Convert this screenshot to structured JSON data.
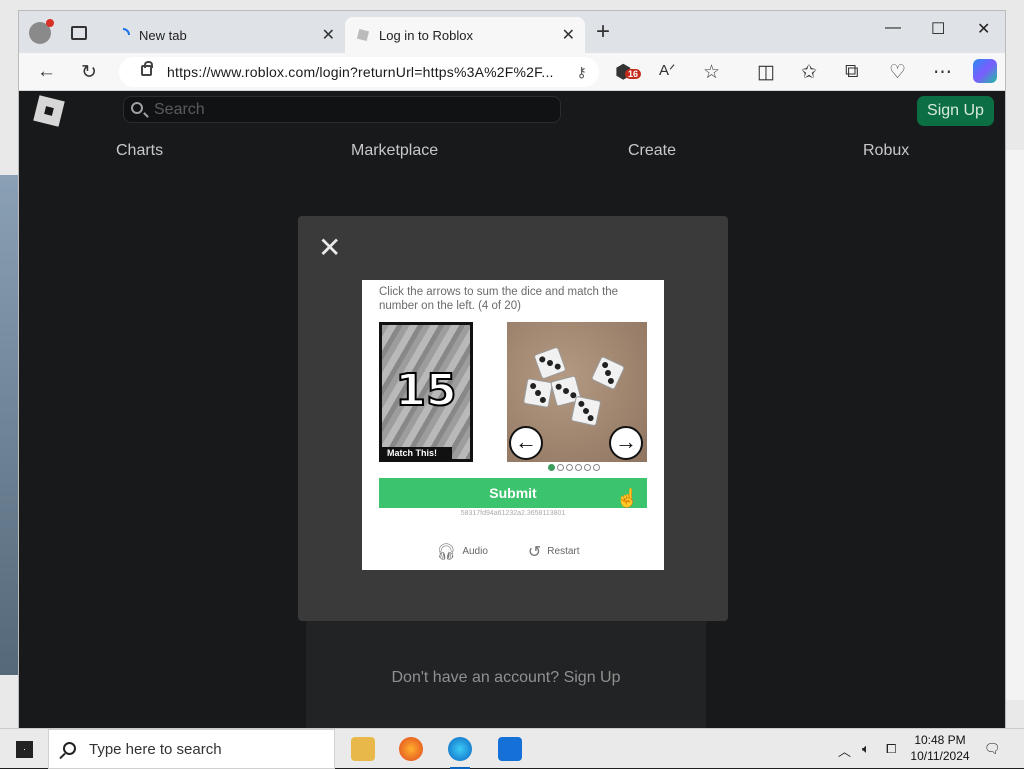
{
  "browser": {
    "tabs": [
      {
        "label": "New tab",
        "active": false
      },
      {
        "label": "Log in to Roblox",
        "active": true
      }
    ],
    "address": "https://www.roblox.com/login?returnUrl=https%3A%2F%2F...",
    "extensions_badge": "16"
  },
  "roblox": {
    "search_placeholder": "Search",
    "signup_label": "Sign Up",
    "nav": [
      "Charts",
      "Marketplace",
      "Create",
      "Robux"
    ],
    "no_account_text": "Don't have an account? Sign Up"
  },
  "captcha": {
    "instruction": "Click the arrows to sum the dice and match the number on the left. (4 of 20)",
    "target_number": "15",
    "match_label": "Match This!",
    "left_arrow": "←",
    "right_arrow": "→",
    "submit_label": "Submit",
    "session_id": "58317fd94a61232a2.3658113801",
    "audio_label": "Audio",
    "restart_label": "Restart",
    "dots_total": 6,
    "dots_active": 1
  },
  "taskbar": {
    "search_placeholder": "Type here to search",
    "time": "10:48 PM",
    "date": "10/11/2024"
  },
  "colors": {
    "roblox_green": "#0c6e43",
    "submit_green": "#3bc36d",
    "page_bg": "#1e1f20"
  }
}
